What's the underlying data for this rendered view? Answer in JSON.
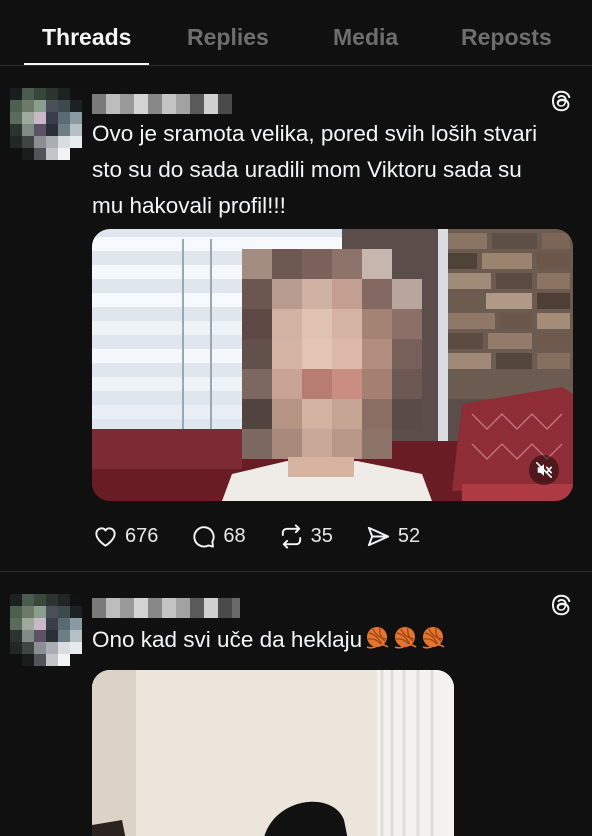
{
  "tabs": [
    {
      "label": "Threads",
      "active": true
    },
    {
      "label": "Replies",
      "active": false
    },
    {
      "label": "Media",
      "active": false
    },
    {
      "label": "Reposts",
      "active": false
    }
  ],
  "posts": [
    {
      "text_lines": [
        "Ovo je sramota velika, pored svih loših stvari",
        "sto su do sada uradili mom Viktoru sada su",
        "mu hakovali profil!!!"
      ],
      "media": {
        "type": "video",
        "muted_icon": "speaker-muted-icon"
      },
      "likes": "676",
      "comments": "68",
      "reposts": "35",
      "shares": "52"
    },
    {
      "text": "Ono kad svi uče da heklaju",
      "emoji": [
        "yarn-ball-emoji",
        "yarn-ball-emoji",
        "yarn-ball-emoji"
      ],
      "media": {
        "type": "image"
      }
    }
  ],
  "colors": {
    "background": "#101010",
    "text": "#f3f5f7",
    "tab_inactive": "#6e6e6e",
    "divider": "#2b2b2b"
  }
}
